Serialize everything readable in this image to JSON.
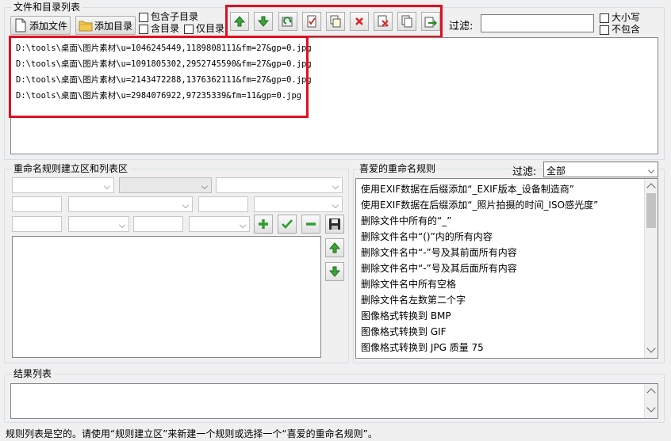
{
  "file_panel": {
    "title": "文件和目录列表",
    "add_file_label": "添加文件",
    "add_dir_label": "添加目录",
    "include_subdir_label": "包含子目录",
    "include_dir_label": "含目录",
    "only_dir_label": "仅目录",
    "filter_label": "过滤:",
    "case_label": "大小写",
    "exclude_label": "不包含",
    "files": [
      "D:\\tools\\桌面\\图片素材\\u=1046245449,1189808111&fm=27&gp=0.jpg",
      "D:\\tools\\桌面\\图片素材\\u=1091805302,2952745590&fm=27&gp=0.jpg",
      "D:\\tools\\桌面\\图片素材\\u=2143472288,1376362111&fm=27&gp=0.jpg",
      "D:\\tools\\桌面\\图片素材\\u=2984076922,97235339&fm=11&gp=0.jpg"
    ]
  },
  "toolbar_icons": [
    "arrow-up-icon",
    "arrow-down-icon",
    "refresh-icon",
    "check-doc-icon",
    "copy-icon",
    "delete-icon",
    "clear-icon",
    "document-icon",
    "export-icon"
  ],
  "rule_panel": {
    "title": "重命名规则建立区和列表区"
  },
  "fav_panel": {
    "title": "喜爱的重命名规则",
    "filter_label": "过滤:",
    "filter_value": "全部",
    "rules": [
      "使用EXIF数据在后缀添加“_EXIF版本_设备制造商”",
      "使用EXIF数据在后缀添加“_照片拍摄的时间_ISO感光度”",
      "删除文件中所有的“_”",
      "删除文件名中“()”内的所有内容",
      "删除文件名中“-”号及其前面所有内容",
      "删除文件名中“-”号及其后面所有内容",
      "删除文件名中所有空格",
      "删除文件名左数第二个字",
      "图像格式转换到 BMP",
      "图像格式转换到 GIF",
      "图像格式转换到 JPG 质量 75"
    ]
  },
  "result_panel": {
    "title": "结果列表"
  },
  "status": {
    "text": "规则列表是空的。请使用“规则建立区”来新建一个规则或选择一个“喜爱的重命名规则”。"
  },
  "colors": {
    "highlight_frame": "#e01020",
    "green": "#2e9d2e",
    "red": "#e02020"
  }
}
